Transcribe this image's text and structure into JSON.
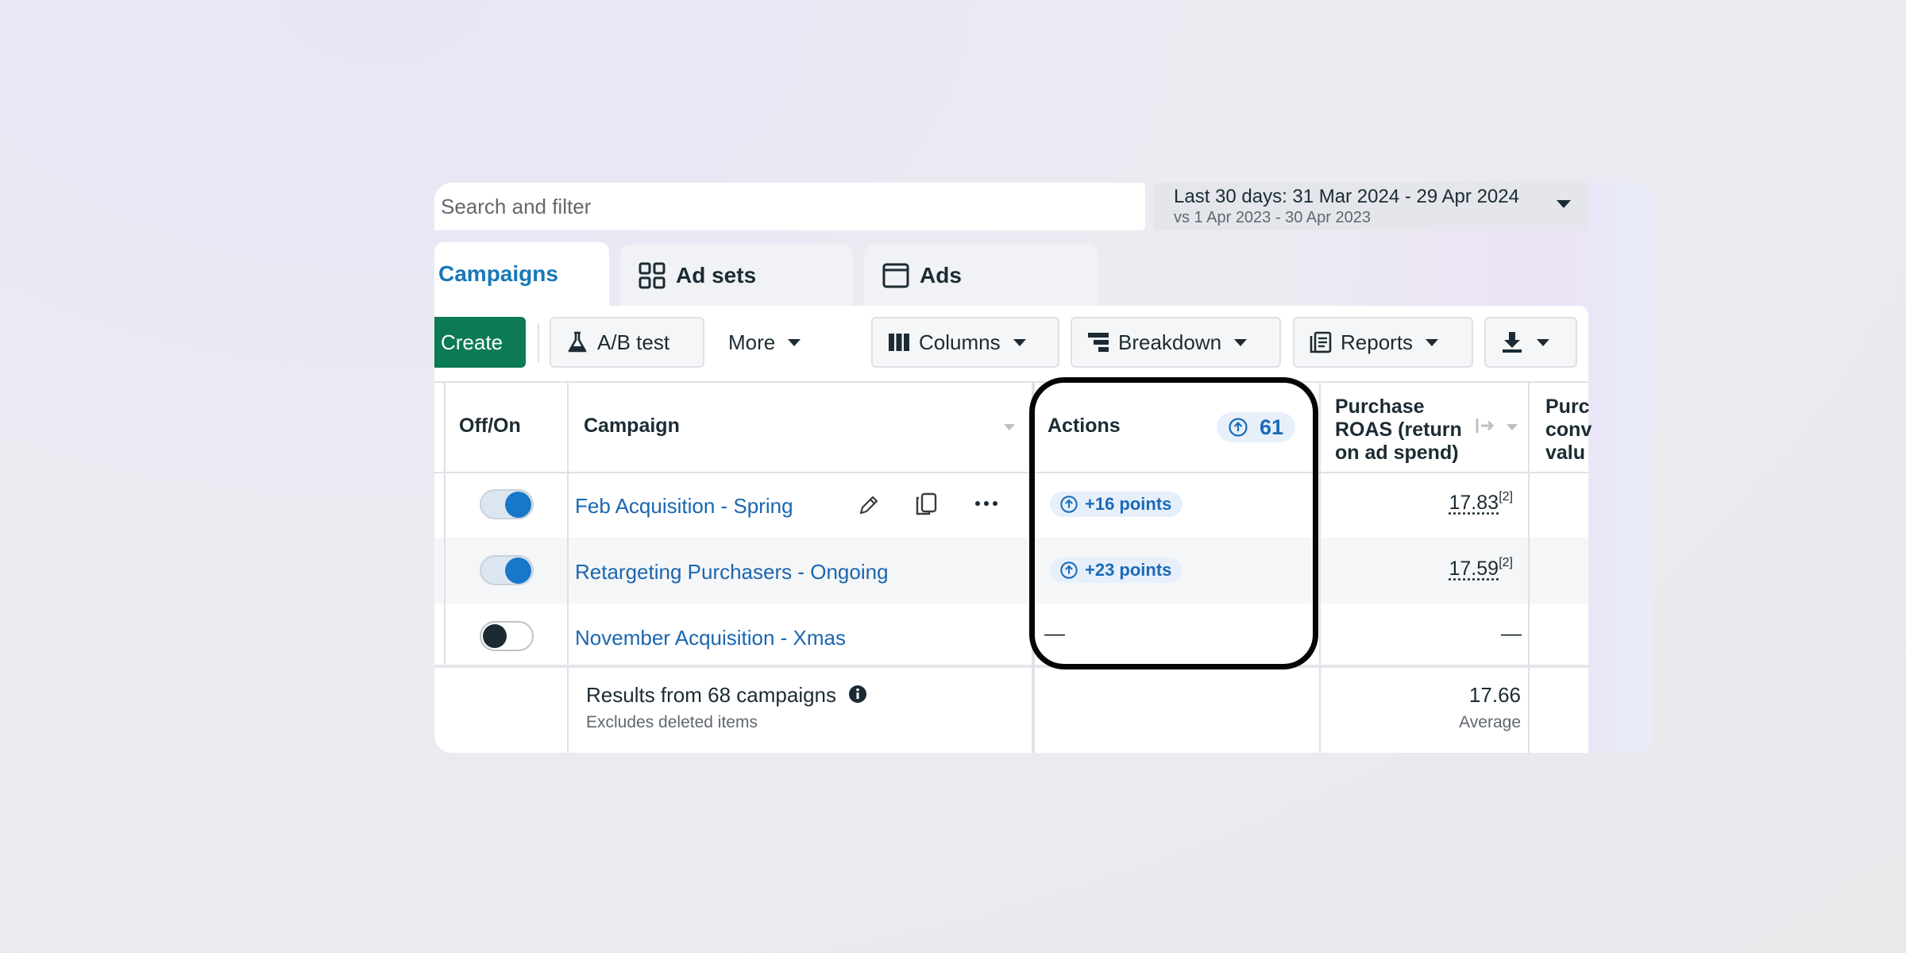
{
  "search": {
    "placeholder": "Search and filter"
  },
  "date_range": {
    "label": "Last 30 days: 31 Mar 2024 - 29 Apr 2024",
    "comparison": "vs 1 Apr 2023 - 30 Apr 2023"
  },
  "tabs": [
    {
      "label": "Campaigns",
      "active": true
    },
    {
      "label": "Ad sets",
      "icon": "grid-icon"
    },
    {
      "label": "Ads",
      "icon": "window-icon"
    }
  ],
  "toolbar": {
    "create": "Create",
    "ab_test": "A/B test",
    "more": "More",
    "columns": "Columns",
    "breakdown": "Breakdown",
    "reports": "Reports"
  },
  "table": {
    "headers": {
      "off_on": "Off/On",
      "campaign": "Campaign",
      "actions": "Actions",
      "actions_count": "61",
      "roas_line1": "Purchase",
      "roas_line2": "ROAS (return",
      "roas_line3": "on ad spend)",
      "next_line1": "Purc",
      "next_line2": "conv",
      "next_line3": "valu"
    },
    "rows": [
      {
        "enabled": true,
        "name": "Feb Acquisition - Spring",
        "action": "+16 points",
        "roas": "17.83",
        "roas_note": "[2]"
      },
      {
        "enabled": true,
        "name": "Retargeting Purchasers - Ongoing",
        "action": "+23 points",
        "roas": "17.59",
        "roas_note": "[2]"
      },
      {
        "enabled": false,
        "name": "November Acquisition - Xmas",
        "action": "—",
        "roas": "—"
      }
    ],
    "footer": {
      "results": "Results from 68 campaigns",
      "excludes": "Excludes deleted items",
      "roas_value": "17.66",
      "roas_label": "Average"
    }
  },
  "colors": {
    "accent_blue": "#1877b8",
    "create_green": "#0b7a55",
    "highlight_outline": "#050505"
  }
}
